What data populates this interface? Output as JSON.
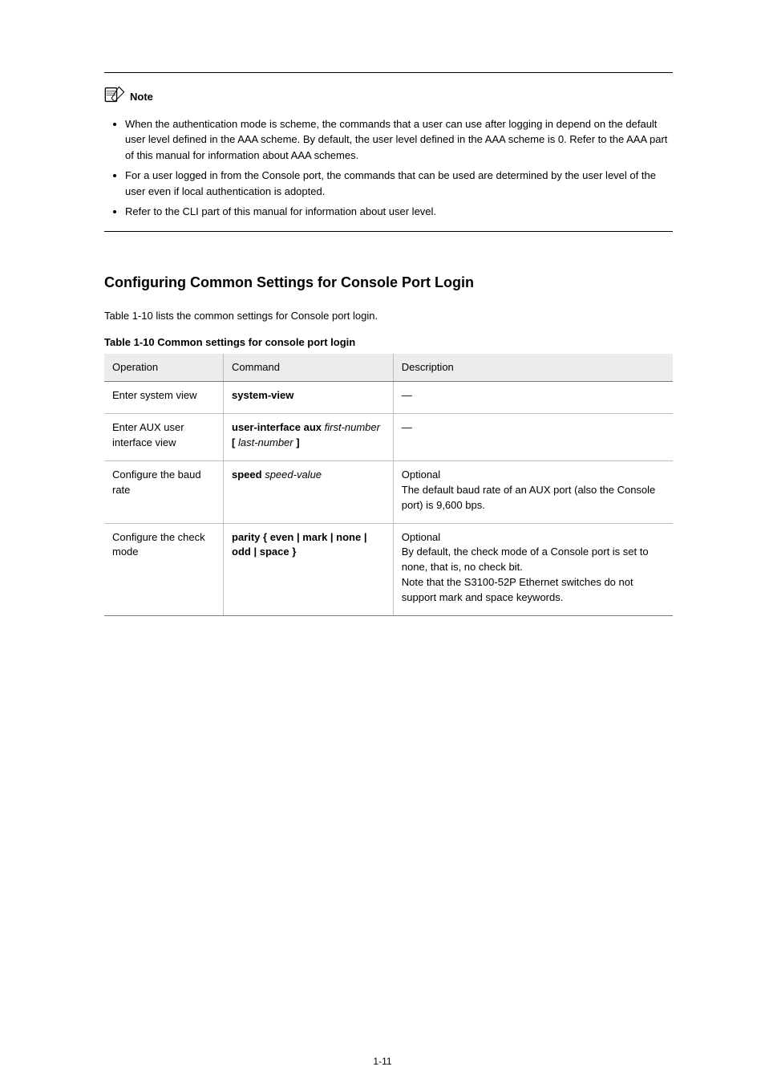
{
  "hr": {},
  "note": {
    "label": "Note",
    "items": [
      "When the authentication mode is scheme, the commands that a user can use after logging in depend on the default user level defined in the AAA scheme. By default, the user level defined in the AAA scheme is 0. Refer to the AAA part of this manual for information about AAA schemes.",
      "For a user logged in from the Console port, the commands that can be used are determined by the user level of the user even if local authentication is adopted.",
      "Refer to the CLI part of this manual for information about user level."
    ]
  },
  "section": {
    "heading": "Configuring Common Settings for Console Port Login",
    "intro": "Table 1-10 lists the common settings for Console port login.",
    "table_caption": "Table 1-10 Common settings for console port login"
  },
  "table": {
    "headers": [
      "Operation",
      "Command",
      "Description"
    ],
    "rows": [
      {
        "op": "Enter system view",
        "cmd_parts": [
          {
            "t": "system-view",
            "arg": false
          }
        ],
        "desc": "—"
      },
      {
        "op": "Enter AUX user interface view",
        "cmd_parts": [
          {
            "t": "user-interface aux ",
            "arg": false
          },
          {
            "t": "first-number ",
            "arg": true
          },
          {
            "t": "[ ",
            "arg": false
          },
          {
            "t": "last-number ",
            "arg": true
          },
          {
            "t": "]",
            "arg": false
          }
        ],
        "desc": "—"
      },
      {
        "op": "Configure the baud rate",
        "cmd_parts": [
          {
            "t": "speed ",
            "arg": false
          },
          {
            "t": "speed-value",
            "arg": true
          }
        ],
        "desc": "Optional\nThe default baud rate of an AUX port (also the Console port) is 9,600 bps."
      },
      {
        "op": "Configure the check mode",
        "cmd_parts": [
          {
            "t": "parity ",
            "arg": false
          },
          {
            "t": "{ ",
            "arg": false
          },
          {
            "t": "even",
            "arg": false
          },
          {
            "t": " | ",
            "arg": false
          },
          {
            "t": "mark",
            "arg": false
          },
          {
            "t": " | ",
            "arg": false
          },
          {
            "t": "none",
            "arg": false
          },
          {
            "t": " | ",
            "arg": false
          },
          {
            "t": "odd",
            "arg": false
          },
          {
            "t": " | ",
            "arg": false
          },
          {
            "t": "space",
            "arg": false
          },
          {
            "t": " }",
            "arg": false
          }
        ],
        "desc": "Optional\nBy default, the check mode of a Console port is set to none, that is, no check bit.\nNote that the S3100-52P Ethernet switches do not support mark and space keywords."
      }
    ]
  },
  "page_num": "1-11"
}
